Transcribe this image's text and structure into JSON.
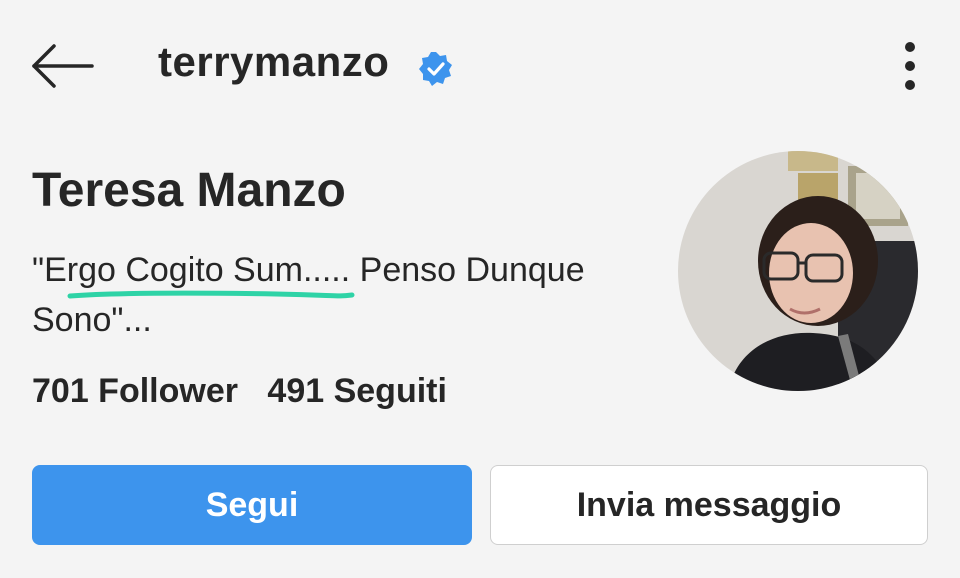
{
  "header": {
    "username": "terrymanzo",
    "back_icon": "arrow-left-icon",
    "verified_icon": "verified-badge-icon",
    "more_icon": "more-vertical-icon"
  },
  "profile": {
    "name": "Teresa Manzo",
    "bio_line1": "\"Ergo Cogito Sum..... Penso Dunque",
    "bio_line2": "Sono\"...",
    "followers": "701 Follower",
    "following": "491 Seguiti"
  },
  "actions": {
    "follow_label": "Segui",
    "message_label": "Invia messaggio"
  },
  "colors": {
    "accent": "#3d94ed",
    "highlight": "#2ed3a6",
    "text": "#262626"
  }
}
